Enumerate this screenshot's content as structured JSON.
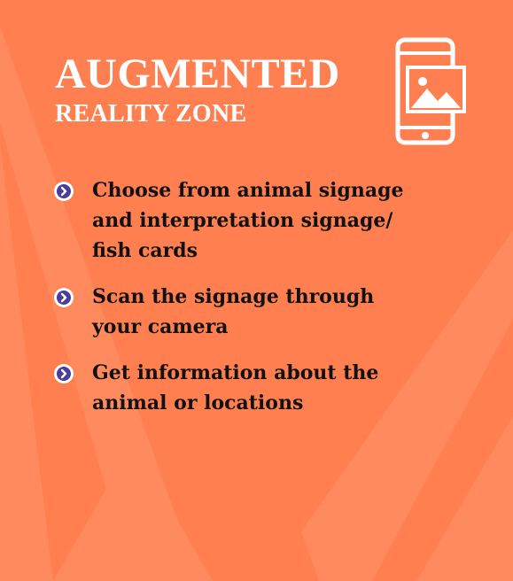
{
  "colors": {
    "background": "#ff7f50",
    "stripe": "#ff8d62",
    "title": "#ffffff",
    "text": "#111111",
    "bullet": "#4b3d9c"
  },
  "header": {
    "title": "AUGMENTED",
    "subtitle": "REALITY ZONE",
    "icon": "phone-image-icon"
  },
  "steps": [
    {
      "icon": "chevron-right-circle-icon",
      "text": "Choose from animal signage and interpretation signage/ fish cards"
    },
    {
      "icon": "chevron-right-circle-icon",
      "text": "Scan the signage through your camera"
    },
    {
      "icon": "chevron-right-circle-icon",
      "text": "Get information about the animal or locations"
    }
  ]
}
